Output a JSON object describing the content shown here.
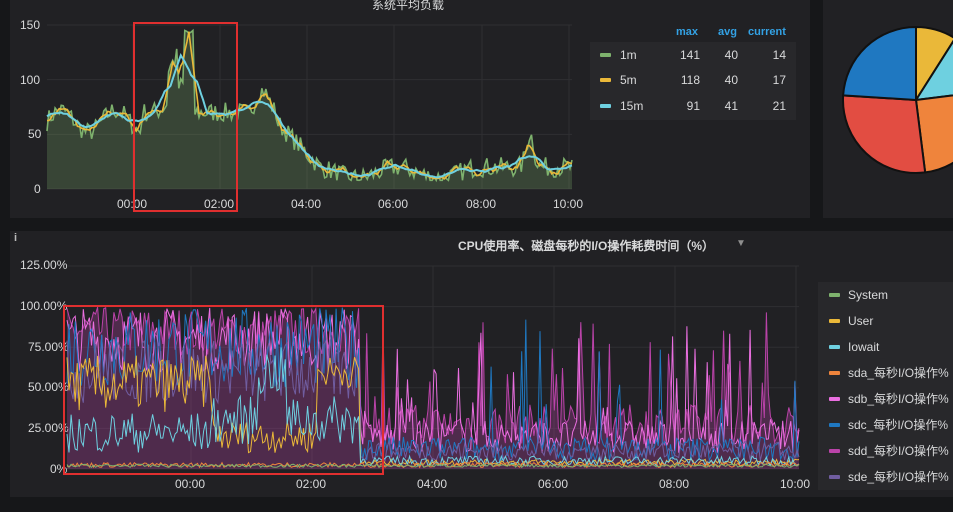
{
  "colors": {
    "s1m": "#7eb26d",
    "s5m": "#eab839",
    "s15m": "#6ed0e0",
    "system": "#7eb26d",
    "user": "#eab839",
    "iowait": "#6ed0e0",
    "sda": "#ef843c",
    "sdb": "#ea6fe0",
    "sdc": "#1f78c1",
    "sdd": "#ba43a9",
    "sde": "#705da0",
    "pie": [
      "#eab839",
      "#6ed0e0",
      "#ef843c",
      "#e24d42",
      "#1f78c1"
    ],
    "highlight": "#e02f2f"
  },
  "panel_load": {
    "title": "系统平均负载",
    "y_ticks": [
      "150",
      "100",
      "50",
      "0"
    ],
    "x_ticks": [
      "00:00",
      "02:00",
      "04:00",
      "06:00",
      "08:00",
      "10:00"
    ],
    "legend": {
      "headers": [
        "max",
        "avg",
        "current"
      ],
      "rows": [
        {
          "name": "1m",
          "max": "141",
          "avg": "40",
          "current": "14"
        },
        {
          "name": "5m",
          "max": "118",
          "avg": "40",
          "current": "17"
        },
        {
          "name": "15m",
          "max": "91",
          "avg": "41",
          "current": "21"
        }
      ]
    }
  },
  "panel_cpu": {
    "info_icon": "info-icon",
    "title": "CPU使用率、磁盘每秒的I/O操作耗费时间（%）",
    "menu_icon": "caret-down-icon",
    "y_ticks": [
      "125.00%",
      "100.00%",
      "75.00%",
      "50.00%",
      "25.00%",
      "0%"
    ],
    "x_ticks": [
      "00:00",
      "02:00",
      "04:00",
      "06:00",
      "08:00",
      "10:00"
    ],
    "legend": [
      "System",
      "User",
      "Iowait",
      "sda_每秒I/O操作%",
      "sdb_每秒I/O操作%",
      "sdc_每秒I/O操作%",
      "sdd_每秒I/O操作%",
      "sde_每秒I/O操作%"
    ]
  },
  "pie": {
    "slice_fractions": [
      0.09,
      0.14,
      0.25,
      0.28,
      0.24
    ]
  }
}
